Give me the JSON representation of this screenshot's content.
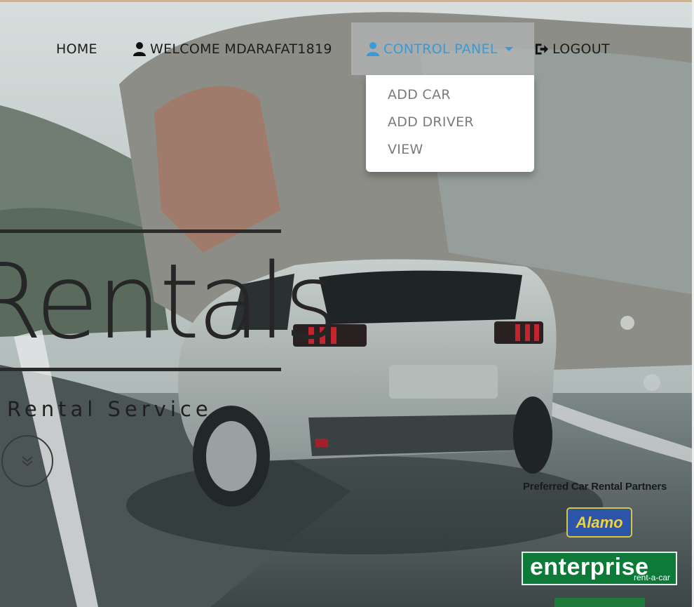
{
  "nav": {
    "home": "HOME",
    "welcome": "WELCOME MDARAFAT1819",
    "control_panel": "CONTROL PANEL",
    "logout": "LOGOUT"
  },
  "dropdown": {
    "items": [
      "ADD CAR",
      "ADD DRIVER",
      "VIEW"
    ]
  },
  "hero": {
    "title": "Rentals",
    "subtitle": "Rental Service"
  },
  "partners": {
    "title": "Preferred Car Rental Partners",
    "logos": [
      "Alamo",
      "enterprise",
      "rent-a-car"
    ]
  },
  "icons": {
    "user": "user-icon",
    "logout": "logout-icon",
    "caret": "caret-down-icon",
    "scroll": "chevron-double-down-icon"
  },
  "colors": {
    "accent": "#3a9ad9",
    "nav_text": "#1c1c1c",
    "dropdown_text": "#7b7b7b"
  }
}
